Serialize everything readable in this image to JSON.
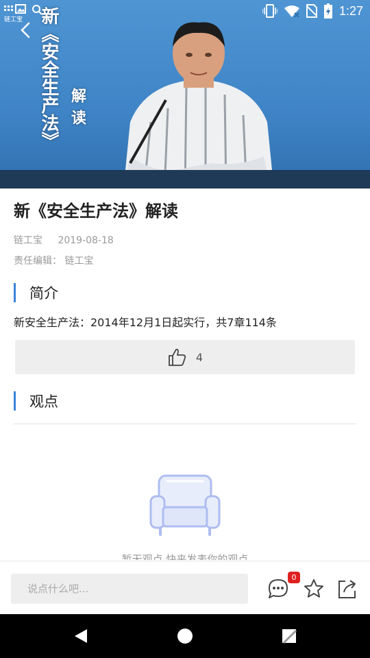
{
  "status_bar": {
    "time": "1:27",
    "app_tag": "链工宝"
  },
  "video": {
    "title": "新《安全生产法》",
    "subtitle": "解读"
  },
  "article": {
    "title": "新《安全生产法》解读",
    "source": "链工宝",
    "date": "2019-08-18",
    "editor": "责任编辑：  链工宝"
  },
  "intro": {
    "heading": "简介",
    "text": "新安全生产法：2014年12月1日起实行，共7章114条"
  },
  "likes": {
    "count": "4"
  },
  "opinions": {
    "heading": "观点",
    "empty_text": "暂无观点 快来发表你的观点"
  },
  "bottom_bar": {
    "placeholder": "说点什么吧...",
    "comment_badge": "0"
  },
  "colors": {
    "accent": "#3b82d6",
    "badge": "#e02020",
    "video_bg": "#4f95d3"
  },
  "icons": [
    "back-icon",
    "thumbs-up-icon",
    "sofa-icon",
    "comment-icon",
    "star-icon",
    "share-icon"
  ]
}
